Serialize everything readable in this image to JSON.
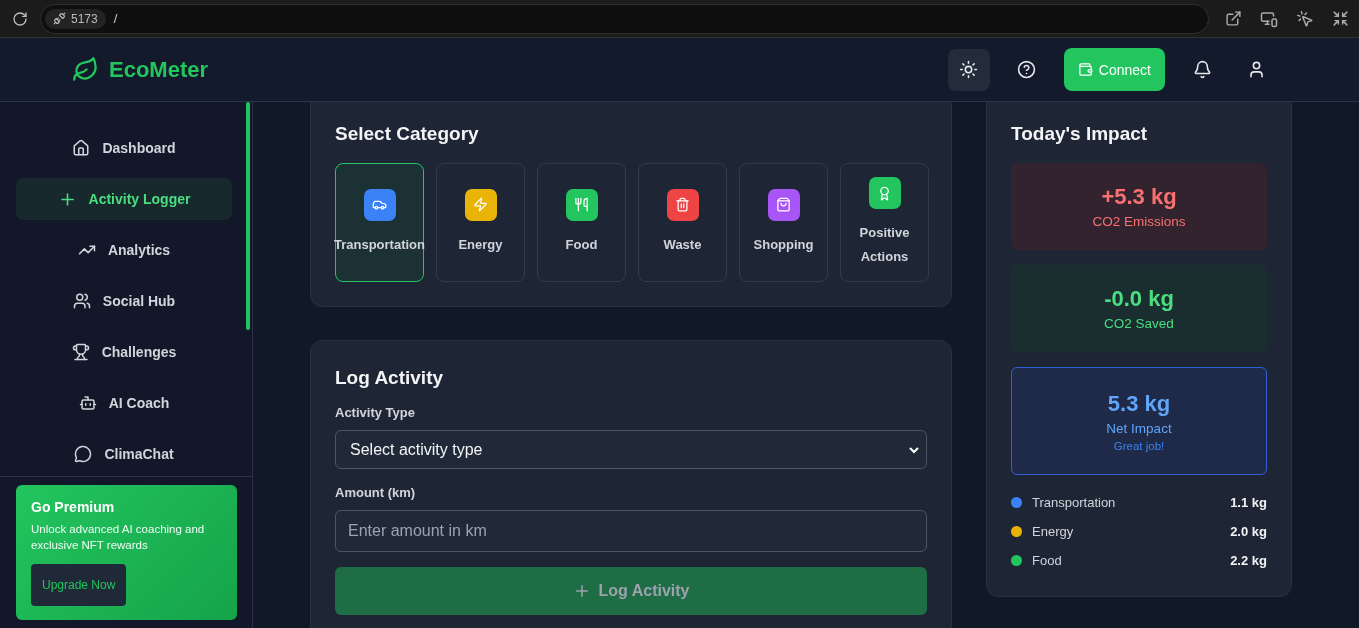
{
  "browser": {
    "port": "5173",
    "path": "/"
  },
  "header": {
    "brand": "EcoMeter",
    "connect": "Connect"
  },
  "sidebar": {
    "items": [
      {
        "label": "Dashboard",
        "selected": false
      },
      {
        "label": "Activity Logger",
        "selected": true
      },
      {
        "label": "Analytics",
        "selected": false
      },
      {
        "label": "Social Hub",
        "selected": false
      },
      {
        "label": "Challenges",
        "selected": false
      },
      {
        "label": "AI Coach",
        "selected": false
      },
      {
        "label": "ClimaChat",
        "selected": false
      }
    ],
    "premium": {
      "title": "Go Premium",
      "text": "Unlock advanced AI coaching and exclusive NFT rewards",
      "button": "Upgrade Now"
    }
  },
  "categories": {
    "title": "Select Category",
    "items": [
      {
        "label": "Transportation",
        "kind": "car",
        "color": "#3b82f6",
        "selected": true
      },
      {
        "label": "Energy",
        "kind": "bolt",
        "color": "#eab308",
        "selected": false
      },
      {
        "label": "Food",
        "kind": "utensils",
        "color": "#22c55e",
        "selected": false
      },
      {
        "label": "Waste",
        "kind": "trash",
        "color": "#ef4444",
        "selected": false
      },
      {
        "label": "Shopping",
        "kind": "bag",
        "color": "#a855f7",
        "selected": false
      },
      {
        "label": "Positive Actions",
        "kind": "award",
        "color": "#22c55e",
        "selected": false
      }
    ]
  },
  "log": {
    "title": "Log Activity",
    "type_label": "Activity Type",
    "type_value": "Select activity type",
    "amount_label": "Amount (km)",
    "amount_placeholder": "Enter amount in km",
    "submit": "Log Activity"
  },
  "impact": {
    "title": "Today's Impact",
    "cards": [
      {
        "kind": "emissions",
        "value": "+5.3 kg",
        "label": "CO2 Emissions"
      },
      {
        "kind": "saved",
        "value": "-0.0 kg",
        "label": "CO2 Saved"
      },
      {
        "kind": "net",
        "value": "5.3 kg",
        "label": "Net Impact",
        "note": "Great job!"
      }
    ],
    "breakdown": [
      {
        "label": "Transportation",
        "value": "1.1 kg",
        "color": "#3b82f6"
      },
      {
        "label": "Energy",
        "value": "2.0 kg",
        "color": "#eab308"
      },
      {
        "label": "Food",
        "value": "2.2 kg",
        "color": "#22c55e"
      }
    ]
  }
}
